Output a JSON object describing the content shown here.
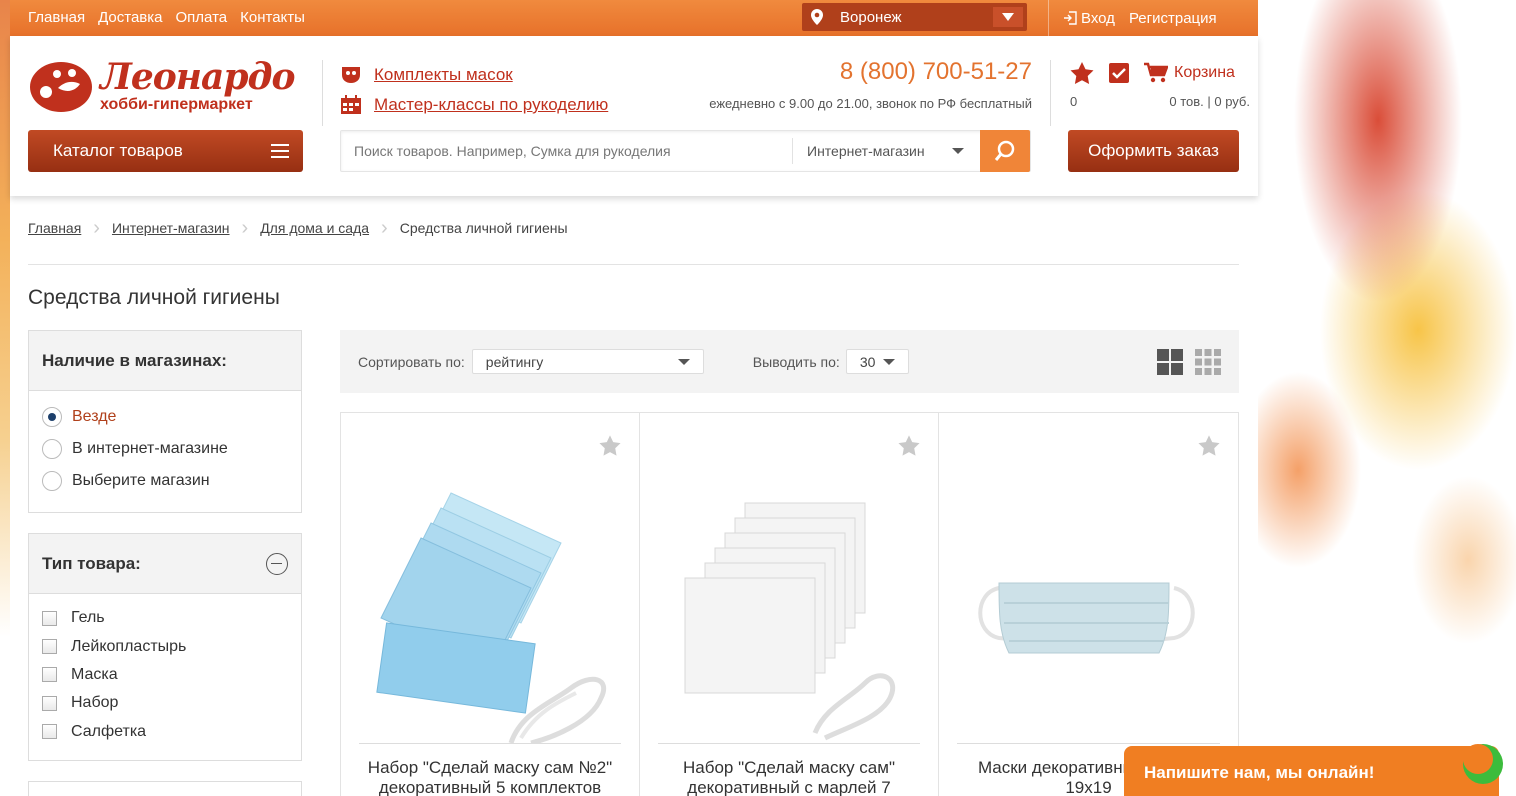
{
  "topbar": {
    "nav": [
      "Главная",
      "Доставка",
      "Оплата",
      "Контакты"
    ],
    "city": "Воронеж",
    "login": "Вход",
    "register": "Регистрация"
  },
  "header": {
    "logo_title": "Леонардо",
    "logo_sub": "хобби-гипермаркет",
    "link1": "Комплекты масок",
    "link2": "Мастер-классы по рукоделию",
    "phone": "8 (800) 700-51-27",
    "hours": "ежедневно с 9.00 до 21.00, звонок по РФ бесплатный",
    "cart_label": "Корзина",
    "fav_count": "0",
    "cart_info": "0 тов. | 0 руб.",
    "catalog_btn": "Каталог товаров",
    "search_placeholder": "Поиск товаров. Например, Сумка для рукоделия",
    "search_scope": "Интернет-магазин",
    "order_btn": "Оформить заказ"
  },
  "breadcrumb": [
    "Главная",
    "Интернет-магазин",
    "Для дома и сада",
    "Средства личной гигиены"
  ],
  "page_title": "Средства личной гигиены",
  "filters": {
    "availability": {
      "title": "Наличие в магазинах:",
      "options": [
        "Везде",
        "В интернет-магазине",
        "Выберите магазин"
      ],
      "selected": "Везде"
    },
    "type": {
      "title": "Тип товара:",
      "options": [
        "Гель",
        "Лейкопластырь",
        "Маска",
        "Набор",
        "Салфетка"
      ]
    }
  },
  "sortbar": {
    "sort_label": "Сортировать по:",
    "sort_value": "рейтингу",
    "perpage_label": "Выводить по:",
    "perpage_value": "30"
  },
  "products": [
    {
      "name": "Набор \"Сделай маску сам №2\" декоративный 5 комплектов"
    },
    {
      "name": "Набор \"Сделай маску сам\" декоративный с марлей 7"
    },
    {
      "name": "Маски декоративные белый 19х19"
    }
  ],
  "chat": {
    "text": "Напишите нам, мы онлайн!"
  },
  "colors": {
    "brand": "#c0301d",
    "accent": "#f08538",
    "topbar": "#e7712a"
  }
}
